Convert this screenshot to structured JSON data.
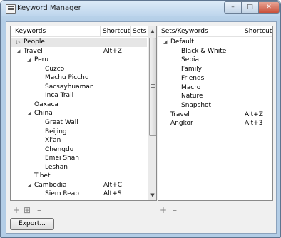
{
  "window": {
    "title": "Keyword Manager"
  },
  "left_panel": {
    "headers": {
      "keywords": "Keywords",
      "shortcut": "Shortcut",
      "sets": "Sets"
    },
    "rows": [
      {
        "label": "People",
        "shortcut": "",
        "level": 0,
        "expander": "collapsed",
        "selected": true
      },
      {
        "label": "Travel",
        "shortcut": "Alt+Z",
        "level": 0,
        "expander": "expanded"
      },
      {
        "label": "Peru",
        "shortcut": "",
        "level": 1,
        "expander": "expanded"
      },
      {
        "label": "Cuzco",
        "shortcut": "",
        "level": 2
      },
      {
        "label": "Machu Picchu",
        "shortcut": "",
        "level": 2
      },
      {
        "label": "Sacsayhuaman",
        "shortcut": "",
        "level": 2
      },
      {
        "label": "Inca Trail",
        "shortcut": "",
        "level": 2
      },
      {
        "label": "Oaxaca",
        "shortcut": "",
        "level": 1
      },
      {
        "label": "China",
        "shortcut": "",
        "level": 1,
        "expander": "expanded"
      },
      {
        "label": "Great Wall",
        "shortcut": "",
        "level": 2
      },
      {
        "label": "Beijing",
        "shortcut": "",
        "level": 2
      },
      {
        "label": "Xi'an",
        "shortcut": "",
        "level": 2
      },
      {
        "label": "Chengdu",
        "shortcut": "",
        "level": 2
      },
      {
        "label": "Emei Shan",
        "shortcut": "",
        "level": 2
      },
      {
        "label": "Leshan",
        "shortcut": "",
        "level": 2
      },
      {
        "label": "Tibet",
        "shortcut": "",
        "level": 1
      },
      {
        "label": "Cambodia",
        "shortcut": "Alt+C",
        "level": 1,
        "expander": "expanded"
      },
      {
        "label": "Siem Reap",
        "shortcut": "Alt+S",
        "level": 2
      }
    ]
  },
  "right_panel": {
    "headers": {
      "sets_keywords": "Sets/Keywords",
      "shortcut": "Shortcut"
    },
    "rows": [
      {
        "label": "Default",
        "shortcut": "",
        "level": 0,
        "expander": "expanded"
      },
      {
        "label": "Black & White",
        "shortcut": "",
        "level": 1
      },
      {
        "label": "Sepia",
        "shortcut": "",
        "level": 1
      },
      {
        "label": "Family",
        "shortcut": "",
        "level": 1
      },
      {
        "label": "Friends",
        "shortcut": "",
        "level": 1
      },
      {
        "label": "Macro",
        "shortcut": "",
        "level": 1
      },
      {
        "label": "Nature",
        "shortcut": "",
        "level": 1
      },
      {
        "label": "Snapshot",
        "shortcut": "",
        "level": 1
      },
      {
        "label": "Travel",
        "shortcut": "Alt+Z",
        "level": 0
      },
      {
        "label": "Angkor",
        "shortcut": "Alt+3",
        "level": 0
      }
    ]
  },
  "buttons": {
    "export_label": "Export..."
  },
  "icons": {
    "add": "plus-icon",
    "add_child": "add-child-icon",
    "remove": "minus-icon",
    "expanded": "triangle-expanded-icon",
    "collapsed": "triangle-collapsed-icon"
  }
}
